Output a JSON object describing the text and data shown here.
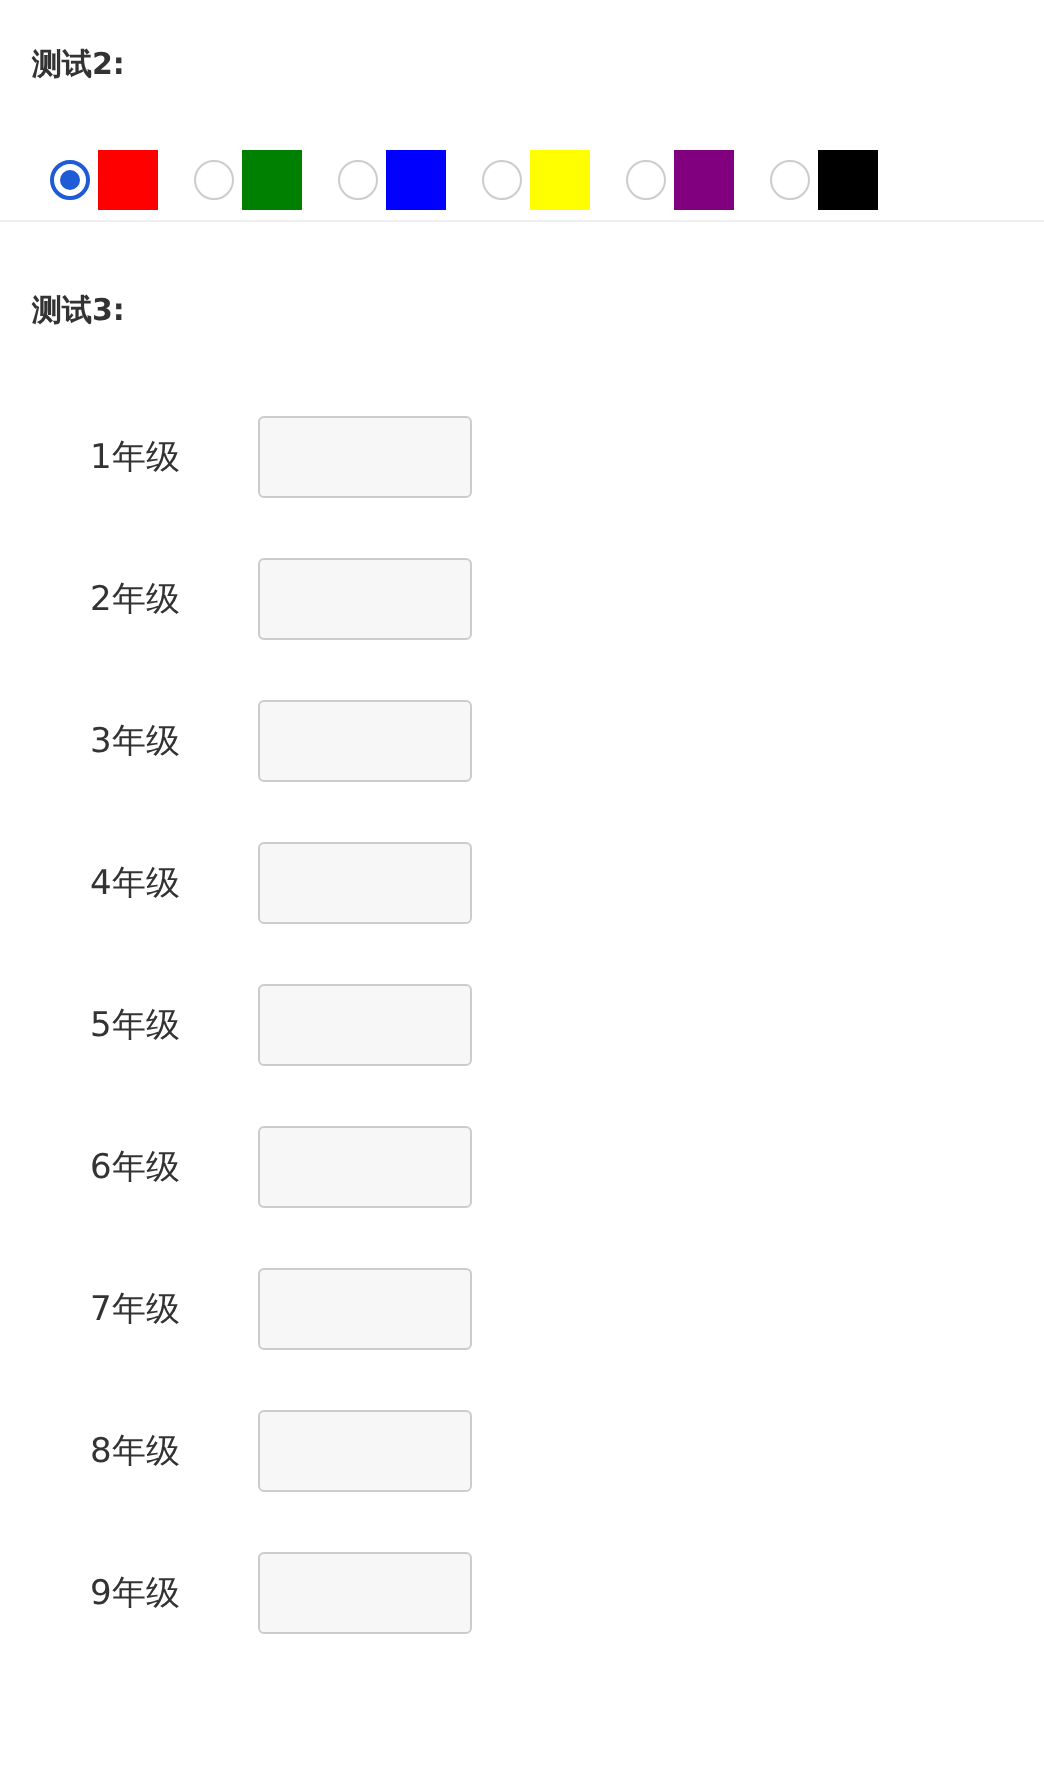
{
  "test2": {
    "title": "测试2:",
    "options": [
      {
        "color": "#ff0000",
        "selected": true
      },
      {
        "color": "#008000",
        "selected": false
      },
      {
        "color": "#0000ff",
        "selected": false
      },
      {
        "color": "#ffff00",
        "selected": false
      },
      {
        "color": "#800080",
        "selected": false
      },
      {
        "color": "#000000",
        "selected": false
      }
    ]
  },
  "test3": {
    "title": "测试3:",
    "rows": [
      {
        "label": "1年级"
      },
      {
        "label": "2年级"
      },
      {
        "label": "3年级"
      },
      {
        "label": "4年级"
      },
      {
        "label": "5年级"
      },
      {
        "label": "6年级"
      },
      {
        "label": "7年级"
      },
      {
        "label": "8年级"
      },
      {
        "label": "9年级"
      }
    ]
  }
}
